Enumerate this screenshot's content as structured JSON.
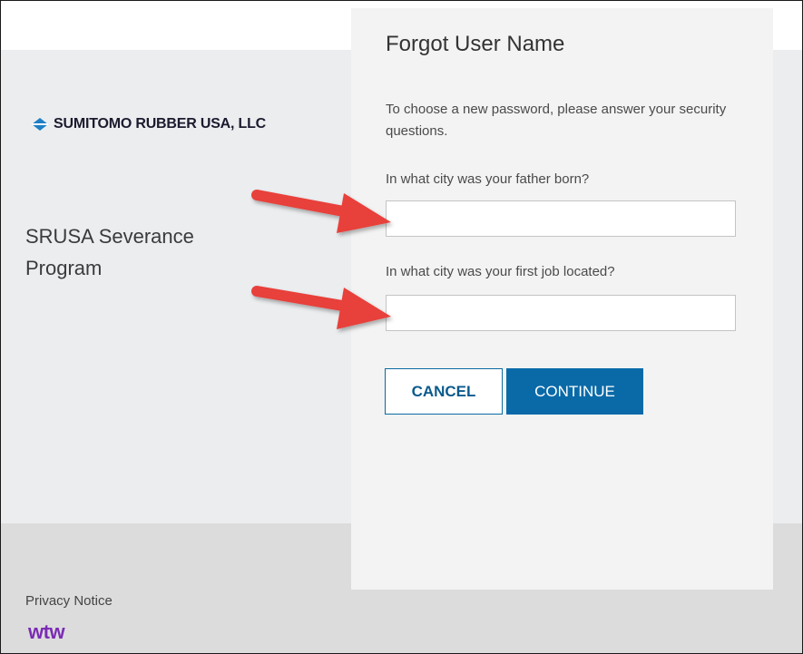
{
  "brand": {
    "name": "SUMITOMO RUBBER USA, LLC",
    "logo_icon": "diamond-logo-icon",
    "logo_color": "#1f7fc4"
  },
  "program": {
    "title": "SRUSA Severance Program"
  },
  "form": {
    "title": "Forgot User Name",
    "instructions": "To choose a new password, please answer your security questions.",
    "questions": [
      {
        "label": "In what city was your father born?",
        "value": "",
        "placeholder": ""
      },
      {
        "label": "In what city was your first job located?",
        "value": "",
        "placeholder": ""
      }
    ],
    "cancel_label": "CANCEL",
    "continue_label": "CONTINUE"
  },
  "footer": {
    "privacy_label": "Privacy Notice",
    "wtw_logo": "wtw"
  },
  "annotations": {
    "arrow_color": "#e8413a",
    "arrow_icon": "red-arrow-icon"
  },
  "colors": {
    "accent": "#0a6aa8",
    "band": "#ebedef",
    "footer": "#dcdcdc",
    "wtw_purple": "#7b2bb5"
  }
}
